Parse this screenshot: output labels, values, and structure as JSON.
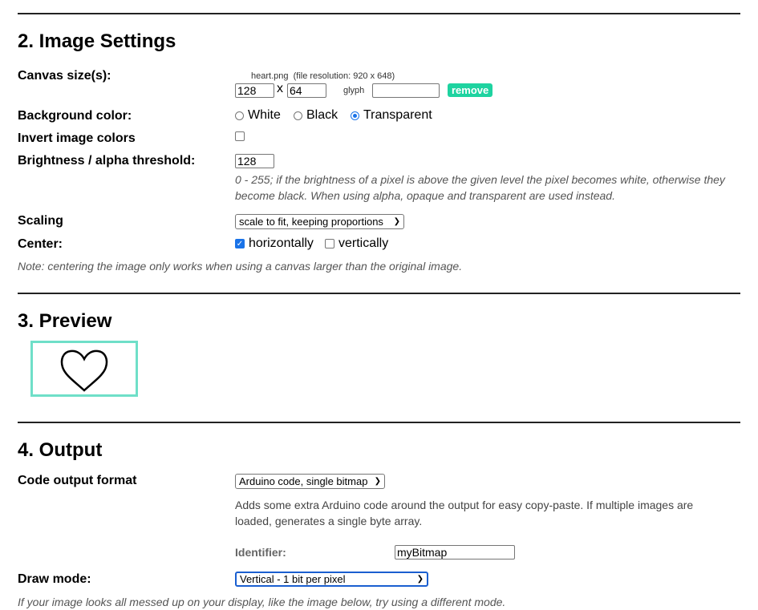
{
  "image_settings": {
    "title": "2. Image Settings",
    "canvas_label": "Canvas size(s):",
    "file_name": "heart.png",
    "file_resolution": "(file resolution: 920 x 648)",
    "width_value": "128",
    "x_label": "x",
    "height_value": "64",
    "glyph_label": "glyph",
    "glyph_value": "",
    "remove_label": "remove",
    "bg_label": "Background color:",
    "bg_options": [
      "White",
      "Black",
      "Transparent"
    ],
    "bg_selected": "Transparent",
    "invert_label": "Invert image colors",
    "invert_checked": false,
    "threshold_label": "Brightness / alpha threshold:",
    "threshold_value": "128",
    "threshold_note": "0 - 255; if the brightness of a pixel is above the given level the pixel becomes white, otherwise they become black. When using alpha, opaque and transparent are used instead.",
    "scaling_label": "Scaling",
    "scaling_value": "scale to fit, keeping proportions",
    "center_label": "Center:",
    "center_h": "horizontally",
    "center_h_checked": true,
    "center_v": "vertically",
    "center_v_checked": false,
    "center_note": "Note: centering the image only works when using a canvas larger than the original image."
  },
  "preview": {
    "title": "3. Preview",
    "border_color": "#6fdfc8"
  },
  "output": {
    "title": "4. Output",
    "format_label": "Code output format",
    "format_value": "Arduino code, single bitmap",
    "format_note": "Adds some extra Arduino code around the output for easy copy-paste. If multiple images are loaded, generates a single byte array.",
    "identifier_label": "Identifier:",
    "identifier_value": "myBitmap",
    "draw_mode_label": "Draw mode:",
    "draw_mode_value": "Vertical - 1 bit per pixel",
    "draw_mode_note": "If your image looks all messed up on your display, like the image below, try using a different mode."
  }
}
